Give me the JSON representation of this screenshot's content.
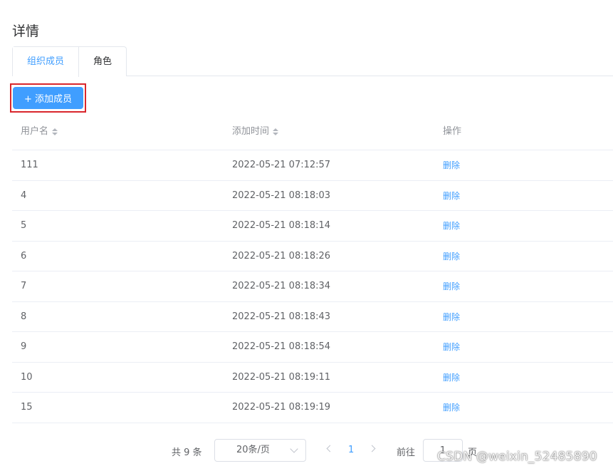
{
  "page": {
    "title": "详情"
  },
  "tabs": [
    {
      "label": "组织成员",
      "active": true
    },
    {
      "label": "角色",
      "active": false
    }
  ],
  "toolbar": {
    "add_label": "+ 添加成员"
  },
  "table": {
    "columns": [
      {
        "label": "用户名",
        "sortable": true
      },
      {
        "label": "添加时间",
        "sortable": true
      },
      {
        "label": "操作",
        "sortable": false
      }
    ],
    "rows": [
      {
        "username": "111",
        "time": "2022-05-21 07:12:57",
        "action": "删除"
      },
      {
        "username": "4",
        "time": "2022-05-21 08:18:03",
        "action": "删除"
      },
      {
        "username": "5",
        "time": "2022-05-21 08:18:14",
        "action": "删除"
      },
      {
        "username": "6",
        "time": "2022-05-21 08:18:26",
        "action": "删除"
      },
      {
        "username": "7",
        "time": "2022-05-21 08:18:34",
        "action": "删除"
      },
      {
        "username": "8",
        "time": "2022-05-21 08:18:43",
        "action": "删除"
      },
      {
        "username": "9",
        "time": "2022-05-21 08:18:54",
        "action": "删除"
      },
      {
        "username": "10",
        "time": "2022-05-21 08:19:11",
        "action": "删除"
      },
      {
        "username": "15",
        "time": "2022-05-21 08:19:19",
        "action": "删除"
      }
    ]
  },
  "pagination": {
    "total_label": "共 9 条",
    "page_size": "20条/页",
    "current_page": "1",
    "goto_label": "前往",
    "goto_value": "1",
    "goto_suffix": "页"
  },
  "watermark": "CSDN @weixin_52485890",
  "colors": {
    "accent": "#409eff",
    "highlight": "#d9262c"
  }
}
